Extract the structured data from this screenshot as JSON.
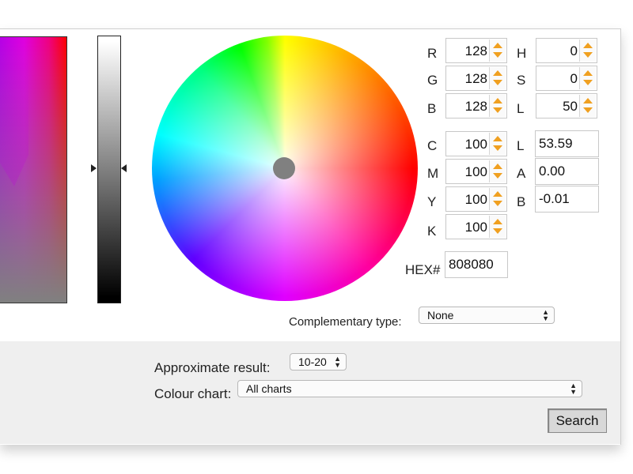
{
  "rgb": {
    "r": {
      "label": "R",
      "value": "128"
    },
    "g": {
      "label": "G",
      "value": "128"
    },
    "b": {
      "label": "B",
      "value": "128"
    }
  },
  "hsl": {
    "h": {
      "label": "H",
      "value": "0"
    },
    "s": {
      "label": "S",
      "value": "0"
    },
    "l": {
      "label": "L",
      "value": "50"
    }
  },
  "cmyk": {
    "c": {
      "label": "C",
      "value": "100"
    },
    "m": {
      "label": "M",
      "value": "100"
    },
    "y": {
      "label": "Y",
      "value": "100"
    },
    "k": {
      "label": "K",
      "value": "100"
    }
  },
  "lab": {
    "l": {
      "label": "L",
      "value": "53.59"
    },
    "a": {
      "label": "A",
      "value": "0.00"
    },
    "b": {
      "label": "B",
      "value": "-0.01"
    }
  },
  "hex": {
    "label": "HEX#",
    "value": "808080"
  },
  "complementary": {
    "label": "Complementary type:",
    "selected": "None"
  },
  "approximate": {
    "label": "Approximate result:",
    "selected": "10-20"
  },
  "colour_chart": {
    "label": "Colour chart:",
    "selected": "All charts"
  },
  "search_label": "Search",
  "colors": {
    "selected_color": "#808080",
    "spinner_arrow": "#f0a020"
  },
  "icons": {
    "spinner_up": "up-arrow-icon",
    "spinner_down": "down-arrow-icon",
    "select_arrows": "updown-arrows-icon"
  }
}
